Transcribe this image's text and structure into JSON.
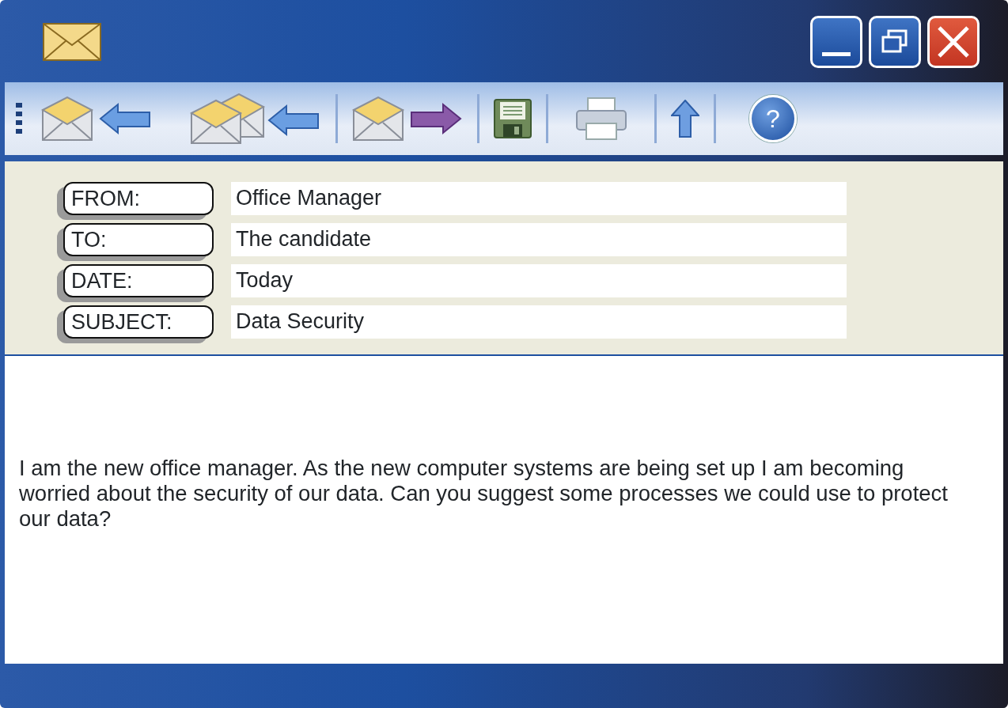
{
  "toolbar": {
    "help": "?"
  },
  "header_fields": [
    {
      "label": "FROM:",
      "value": "Office Manager"
    },
    {
      "label": "TO:",
      "value": "The candidate"
    },
    {
      "label": "DATE:",
      "value": "Today"
    },
    {
      "label": "SUBJECT:",
      "value": "Data Security"
    }
  ],
  "message": {
    "body": "I am the new office manager. As the new computer systems are being set up I am becoming worried about the security of our data. Can you suggest some processes we could use to protect our data?"
  }
}
